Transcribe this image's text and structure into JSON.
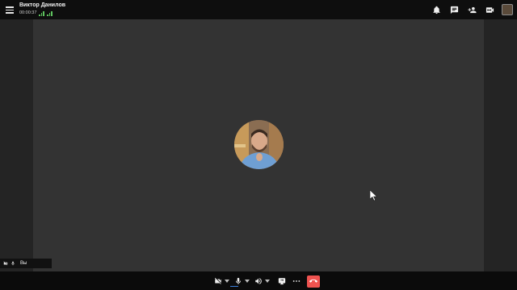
{
  "header": {
    "caller_name": "Виктор Данилов",
    "call_timer": "00:00:37",
    "icons": [
      "menu-icon",
      "bell-icon",
      "chat-icon",
      "add-user-icon",
      "video-switch-icon",
      "self-view-thumbnail"
    ]
  },
  "participant": {
    "avatar": "user-photo"
  },
  "self_view": {
    "label": "Вы"
  },
  "controls": {
    "items": [
      "camera-off-icon",
      "microphone-icon",
      "speaker-icon",
      "screen-share-icon",
      "more-icon",
      "hang-up-icon"
    ],
    "hangup_color": "#ef5350"
  },
  "colors": {
    "accent_green": "#5ec35e",
    "hangup_red": "#ef5350"
  }
}
